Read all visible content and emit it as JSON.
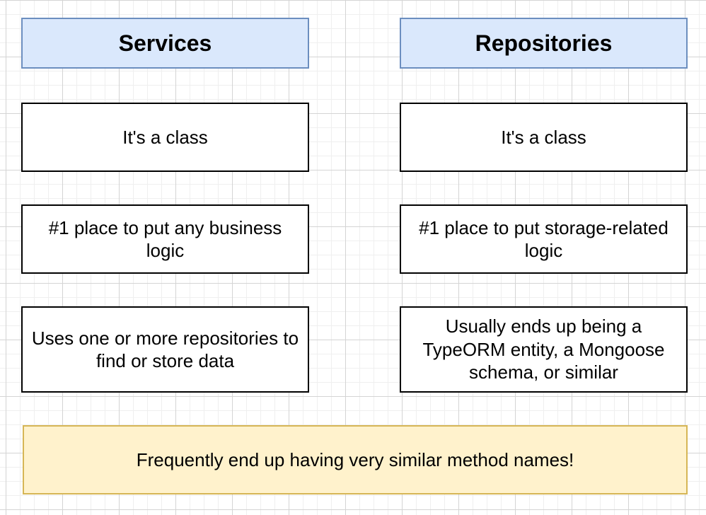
{
  "services": {
    "title": "Services",
    "items": [
      "It's a class",
      "#1 place to put any business logic",
      "Uses one or more repositories to find or store data"
    ]
  },
  "repositories": {
    "title": "Repositories",
    "items": [
      "It's a class",
      "#1 place to put storage-related logic",
      "Usually ends up being a TypeORM entity, a Mongoose schema, or similar"
    ]
  },
  "footer_note": "Frequently end up having very similar method names!",
  "colors": {
    "header_fill": "#dae8fc",
    "header_stroke": "#6c8ebf",
    "note_fill": "#fff2cc",
    "note_stroke": "#d6b656",
    "box_stroke": "#000000"
  }
}
